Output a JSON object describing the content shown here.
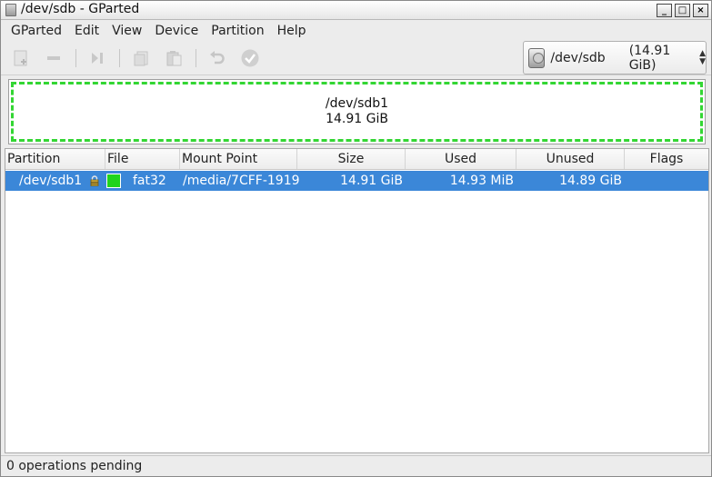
{
  "window": {
    "title": "/dev/sdb - GParted",
    "buttons": [
      "_",
      "□",
      "×"
    ]
  },
  "menubar": {
    "items": [
      "GParted",
      "Edit",
      "View",
      "Device",
      "Partition",
      "Help"
    ]
  },
  "toolbar": {
    "icons": [
      "new-icon",
      "delete-icon",
      "resize-move-icon",
      "copy-icon",
      "paste-icon",
      "undo-icon",
      "apply-icon"
    ],
    "device_selector": {
      "device": "/dev/sdb",
      "size": "(14.91 GiB)"
    }
  },
  "partition_map": {
    "name": "/dev/sdb1",
    "size": "14.91 GiB",
    "color": "#33d633"
  },
  "table": {
    "columns": [
      "Partition",
      "File System",
      "Mount Point",
      "Size",
      "Used",
      "Unused",
      "Flags"
    ],
    "rows": [
      {
        "partition": "/dev/sdb1",
        "file_system": "fat32",
        "fs_color": "#20d41c",
        "mount_point": "/media/7CFF-1919",
        "size": "14.91 GiB",
        "used": "14.93 MiB",
        "unused": "14.89 GiB",
        "flags": ""
      }
    ],
    "selection_color": "#3b87d8"
  },
  "statusbar": {
    "text": "0 operations pending"
  }
}
